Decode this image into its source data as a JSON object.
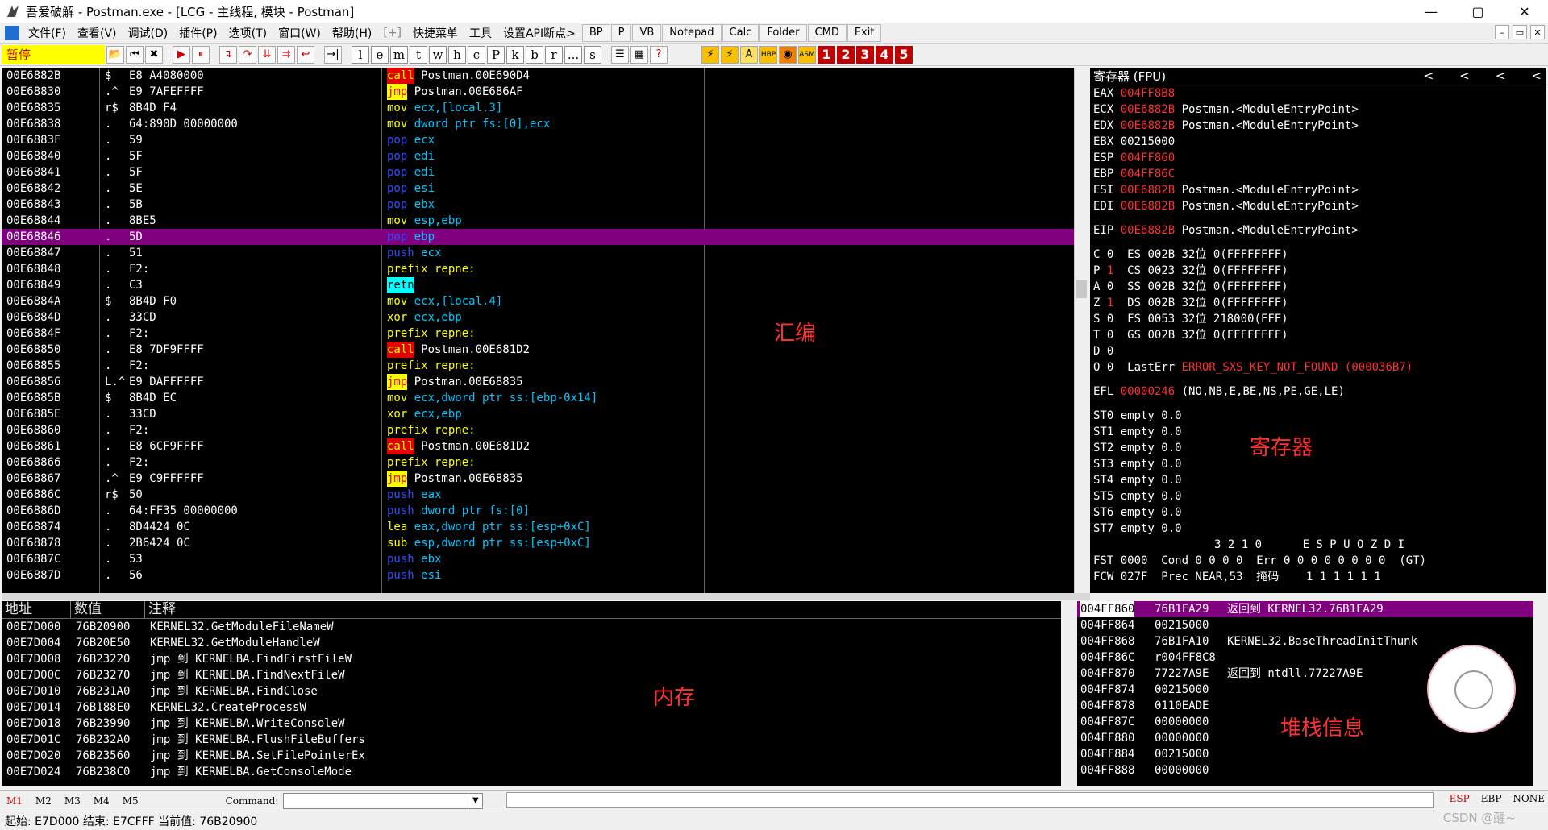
{
  "titlebar": {
    "title": "吾爱破解 - Postman.exe - [LCG - 主线程, 模块 - Postman]",
    "min": "—",
    "max": "▢",
    "close": "✕"
  },
  "menubar": {
    "items": [
      "文件(F)",
      "查看(V)",
      "调试(D)",
      "插件(P)",
      "选项(T)",
      "窗口(W)",
      "帮助(H)",
      "[+]",
      "快捷菜单",
      "工具",
      "设置API断点>"
    ],
    "tools": [
      "BP",
      "P",
      "VB",
      "Notepad",
      "Calc",
      "Folder",
      "CMD",
      "Exit"
    ],
    "mdi": [
      "–",
      "▭",
      "✕"
    ]
  },
  "toolbar": {
    "status": "暂停",
    "letters": [
      "l",
      "e",
      "m",
      "t",
      "w",
      "h",
      "c",
      "P",
      "k",
      "b",
      "r",
      "...",
      "s"
    ],
    "numbers": [
      "1",
      "2",
      "3",
      "4",
      "5"
    ]
  },
  "cpu": {
    "rows": [
      {
        "addr": "00E6882B",
        "mark": "$",
        "hex": "E8 A4080000",
        "asm_k": "call",
        "asm_op": "Postman.00E690D4",
        "k": "call"
      },
      {
        "addr": "00E68830",
        "mark": ".^",
        "hex": "E9 7AFEFFFF",
        "asm_k": "jmp",
        "asm_op": "Postman.00E686AF",
        "k": "jmp"
      },
      {
        "addr": "00E68835",
        "mark": "r$",
        "hex": "8B4D F4",
        "asm_k": "mov",
        "asm_op": "ecx,[local.3]",
        "k": "mov"
      },
      {
        "addr": "00E68838",
        "mark": ".",
        "hex": "64:890D 00000000",
        "asm_k": "mov",
        "asm_op": "dword ptr fs:[0],ecx",
        "k": "mov"
      },
      {
        "addr": "00E6883F",
        "mark": ".",
        "hex": "59",
        "asm_k": "pop",
        "asm_op": "ecx",
        "k": "pop"
      },
      {
        "addr": "00E68840",
        "mark": ".",
        "hex": "5F",
        "asm_k": "pop",
        "asm_op": "edi",
        "k": "pop"
      },
      {
        "addr": "00E68841",
        "mark": ".",
        "hex": "5F",
        "asm_k": "pop",
        "asm_op": "edi",
        "k": "pop"
      },
      {
        "addr": "00E68842",
        "mark": ".",
        "hex": "5E",
        "asm_k": "pop",
        "asm_op": "esi",
        "k": "pop"
      },
      {
        "addr": "00E68843",
        "mark": ".",
        "hex": "5B",
        "asm_k": "pop",
        "asm_op": "ebx",
        "k": "pop"
      },
      {
        "addr": "00E68844",
        "mark": ".",
        "hex": "8BE5",
        "asm_k": "mov",
        "asm_op": "esp,ebp",
        "k": "mov"
      },
      {
        "addr": "00E68846",
        "mark": ".",
        "hex": "5D",
        "asm_k": "pop",
        "asm_op": "ebp",
        "k": "pop",
        "sel": true
      },
      {
        "addr": "00E68847",
        "mark": ".",
        "hex": "51",
        "asm_k": "push",
        "asm_op": "ecx",
        "k": "push"
      },
      {
        "addr": "00E68848",
        "mark": ".",
        "hex": "F2:",
        "asm_k": "prefix repne:",
        "asm_op": "",
        "k": "prefix"
      },
      {
        "addr": "00E68849",
        "mark": ".",
        "hex": "C3",
        "asm_k": "retn",
        "asm_op": "",
        "k": "retn"
      },
      {
        "addr": "00E6884A",
        "mark": "$",
        "hex": "8B4D F0",
        "asm_k": "mov",
        "asm_op": "ecx,[local.4]",
        "k": "mov"
      },
      {
        "addr": "00E6884D",
        "mark": ".",
        "hex": "33CD",
        "asm_k": "xor",
        "asm_op": "ecx,ebp",
        "k": "mov"
      },
      {
        "addr": "00E6884F",
        "mark": ".",
        "hex": "F2:",
        "asm_k": "prefix repne:",
        "asm_op": "",
        "k": "prefix"
      },
      {
        "addr": "00E68850",
        "mark": ".",
        "hex": "E8 7DF9FFFF",
        "asm_k": "call",
        "asm_op": "Postman.00E681D2",
        "k": "call"
      },
      {
        "addr": "00E68855",
        "mark": ".",
        "hex": "F2:",
        "asm_k": "prefix repne:",
        "asm_op": "",
        "k": "prefix"
      },
      {
        "addr": "00E68856",
        "mark": "L.^",
        "hex": "E9 DAFFFFFF",
        "asm_k": "jmp",
        "asm_op": "Postman.00E68835",
        "k": "jmp"
      },
      {
        "addr": "00E6885B",
        "mark": "$",
        "hex": "8B4D EC",
        "asm_k": "mov",
        "asm_op": "ecx,dword ptr ss:[ebp-0x14]",
        "k": "mov"
      },
      {
        "addr": "00E6885E",
        "mark": ".",
        "hex": "33CD",
        "asm_k": "xor",
        "asm_op": "ecx,ebp",
        "k": "mov"
      },
      {
        "addr": "00E68860",
        "mark": ".",
        "hex": "F2:",
        "asm_k": "prefix repne:",
        "asm_op": "",
        "k": "prefix"
      },
      {
        "addr": "00E68861",
        "mark": ".",
        "hex": "E8 6CF9FFFF",
        "asm_k": "call",
        "asm_op": "Postman.00E681D2",
        "k": "call"
      },
      {
        "addr": "00E68866",
        "mark": ".",
        "hex": "F2:",
        "asm_k": "prefix repne:",
        "asm_op": "",
        "k": "prefix"
      },
      {
        "addr": "00E68867",
        "mark": ".^",
        "hex": "E9 C9FFFFFF",
        "asm_k": "jmp",
        "asm_op": "Postman.00E68835",
        "k": "jmp"
      },
      {
        "addr": "00E6886C",
        "mark": "r$",
        "hex": "50",
        "asm_k": "push",
        "asm_op": "eax",
        "k": "push"
      },
      {
        "addr": "00E6886D",
        "mark": ".",
        "hex": "64:FF35 00000000",
        "asm_k": "push",
        "asm_op": "dword ptr fs:[0]",
        "k": "push"
      },
      {
        "addr": "00E68874",
        "mark": ".",
        "hex": "8D4424 0C",
        "asm_k": "lea",
        "asm_op": "eax,dword ptr ss:[esp+0xC]",
        "k": "lea"
      },
      {
        "addr": "00E68878",
        "mark": ".",
        "hex": "2B6424 0C",
        "asm_k": "sub",
        "asm_op": "esp,dword ptr ss:[esp+0xC]",
        "k": "lea"
      },
      {
        "addr": "00E6887C",
        "mark": ".",
        "hex": "53",
        "asm_k": "push",
        "asm_op": "ebx",
        "k": "push"
      },
      {
        "addr": "00E6887D",
        "mark": ".",
        "hex": "56",
        "asm_k": "push",
        "asm_op": "esi",
        "k": "push"
      }
    ],
    "label": "汇编"
  },
  "registers": {
    "header": "寄存器 (FPU)",
    "arrows": [
      "<",
      "<",
      "<",
      "<"
    ],
    "gp": [
      {
        "n": "EAX",
        "v": "004FF8B8",
        "c": "",
        "red": true
      },
      {
        "n": "ECX",
        "v": "00E6882B",
        "c": "Postman.<ModuleEntryPoint>",
        "red": true
      },
      {
        "n": "EDX",
        "v": "00E6882B",
        "c": "Postman.<ModuleEntryPoint>",
        "red": true
      },
      {
        "n": "EBX",
        "v": "00215000",
        "c": "",
        "red": false
      },
      {
        "n": "ESP",
        "v": "004FF860",
        "c": "",
        "red": true
      },
      {
        "n": "EBP",
        "v": "004FF86C",
        "c": "",
        "red": true
      },
      {
        "n": "ESI",
        "v": "00E6882B",
        "c": "Postman.<ModuleEntryPoint>",
        "red": true
      },
      {
        "n": "EDI",
        "v": "00E6882B",
        "c": "Postman.<ModuleEntryPoint>",
        "red": true
      }
    ],
    "eip": {
      "n": "EIP",
      "v": "00E6882B",
      "c": "Postman.<ModuleEntryPoint>"
    },
    "flags": [
      {
        "f": "C",
        "v": "0",
        "red": false,
        "seg": "ES 002B 32位 0(FFFFFFFF)"
      },
      {
        "f": "P",
        "v": "1",
        "red": true,
        "seg": "CS 0023 32位 0(FFFFFFFF)"
      },
      {
        "f": "A",
        "v": "0",
        "red": false,
        "seg": "SS 002B 32位 0(FFFFFFFF)"
      },
      {
        "f": "Z",
        "v": "1",
        "red": true,
        "seg": "DS 002B 32位 0(FFFFFFFF)"
      },
      {
        "f": "S",
        "v": "0",
        "red": false,
        "seg": "FS 0053 32位 218000(FFF)"
      },
      {
        "f": "T",
        "v": "0",
        "red": false,
        "seg": "GS 002B 32位 0(FFFFFFFF)"
      },
      {
        "f": "D",
        "v": "0",
        "red": false,
        "seg": ""
      },
      {
        "f": "O",
        "v": "0",
        "red": false,
        "seg": "LastErr"
      }
    ],
    "lasterr": "ERROR_SXS_KEY_NOT_FOUND (000036B7)",
    "efl_label": "EFL",
    "efl_val": "00000246",
    "efl_desc": "(NO,NB,E,BE,NS,PE,GE,LE)",
    "fpu": [
      "ST0 empty 0.0",
      "ST1 empty 0.0",
      "ST2 empty 0.0",
      "ST3 empty 0.0",
      "ST4 empty 0.0",
      "ST5 empty 0.0",
      "ST6 empty 0.0",
      "ST7 empty 0.0"
    ],
    "fpu_hdr": "3 2 1 0      E S P U O Z D I",
    "fst": "FST 0000  Cond 0 0 0 0  Err 0 0 0 0 0 0 0 0  (GT)",
    "fcw": "FCW 027F  Prec NEAR,53  掩码    1 1 1 1 1 1",
    "label": "寄存器"
  },
  "memory": {
    "headers": [
      "地址",
      "数值",
      "注释"
    ],
    "rows": [
      {
        "a": "00E7D000",
        "v": "76B20900",
        "c": "KERNEL32.GetModuleFileNameW"
      },
      {
        "a": "00E7D004",
        "v": "76B20E50",
        "c": "KERNEL32.GetModuleHandleW"
      },
      {
        "a": "00E7D008",
        "v": "76B23220",
        "c": "jmp 到 KERNELBA.FindFirstFileW"
      },
      {
        "a": "00E7D00C",
        "v": "76B23270",
        "c": "jmp 到 KERNELBA.FindNextFileW"
      },
      {
        "a": "00E7D010",
        "v": "76B231A0",
        "c": "jmp 到 KERNELBA.FindClose"
      },
      {
        "a": "00E7D014",
        "v": "76B188E0",
        "c": "KERNEL32.CreateProcessW"
      },
      {
        "a": "00E7D018",
        "v": "76B23990",
        "c": "jmp 到 KERNELBA.WriteConsoleW"
      },
      {
        "a": "00E7D01C",
        "v": "76B232A0",
        "c": "jmp 到 KERNELBA.FlushFileBuffers"
      },
      {
        "a": "00E7D020",
        "v": "76B23560",
        "c": "jmp 到 KERNELBA.SetFilePointerEx"
      },
      {
        "a": "00E7D024",
        "v": "76B238C0",
        "c": "jmp 到 KERNELBA.GetConsoleMode"
      }
    ],
    "label": "内存"
  },
  "stack": {
    "rows": [
      {
        "a": "004FF860",
        "v": "76B1FA29",
        "c": "返回到 KERNEL32.76B1FA29",
        "sel": true
      },
      {
        "a": "004FF864",
        "v": "00215000",
        "c": ""
      },
      {
        "a": "004FF868",
        "v": "76B1FA10",
        "c": "KERNEL32.BaseThreadInitThunk"
      },
      {
        "a": "004FF86C",
        "v": "r004FF8C8",
        "c": ""
      },
      {
        "a": "004FF870",
        "v": "77227A9E",
        "c": "返回到 ntdll.77227A9E"
      },
      {
        "a": "004FF874",
        "v": "00215000",
        "c": ""
      },
      {
        "a": "004FF878",
        "v": "0110EADE",
        "c": ""
      },
      {
        "a": "004FF87C",
        "v": "00000000",
        "c": ""
      },
      {
        "a": "004FF880",
        "v": "00000000",
        "c": ""
      },
      {
        "a": "004FF884",
        "v": "00215000",
        "c": ""
      },
      {
        "a": "004FF888",
        "v": "00000000",
        "c": ""
      }
    ],
    "label": "堆栈信息"
  },
  "cmdbar": {
    "mbtns": [
      "M1",
      "M2",
      "M3",
      "M4",
      "M5"
    ],
    "command_label": "Command:",
    "rbtns": [
      "ESP",
      "EBP",
      "NONE"
    ]
  },
  "statusbar": {
    "text": "起始: E7D000  结束: E7CFFF  当前值: 76B20900"
  },
  "watermark": "CSDN @醒~"
}
